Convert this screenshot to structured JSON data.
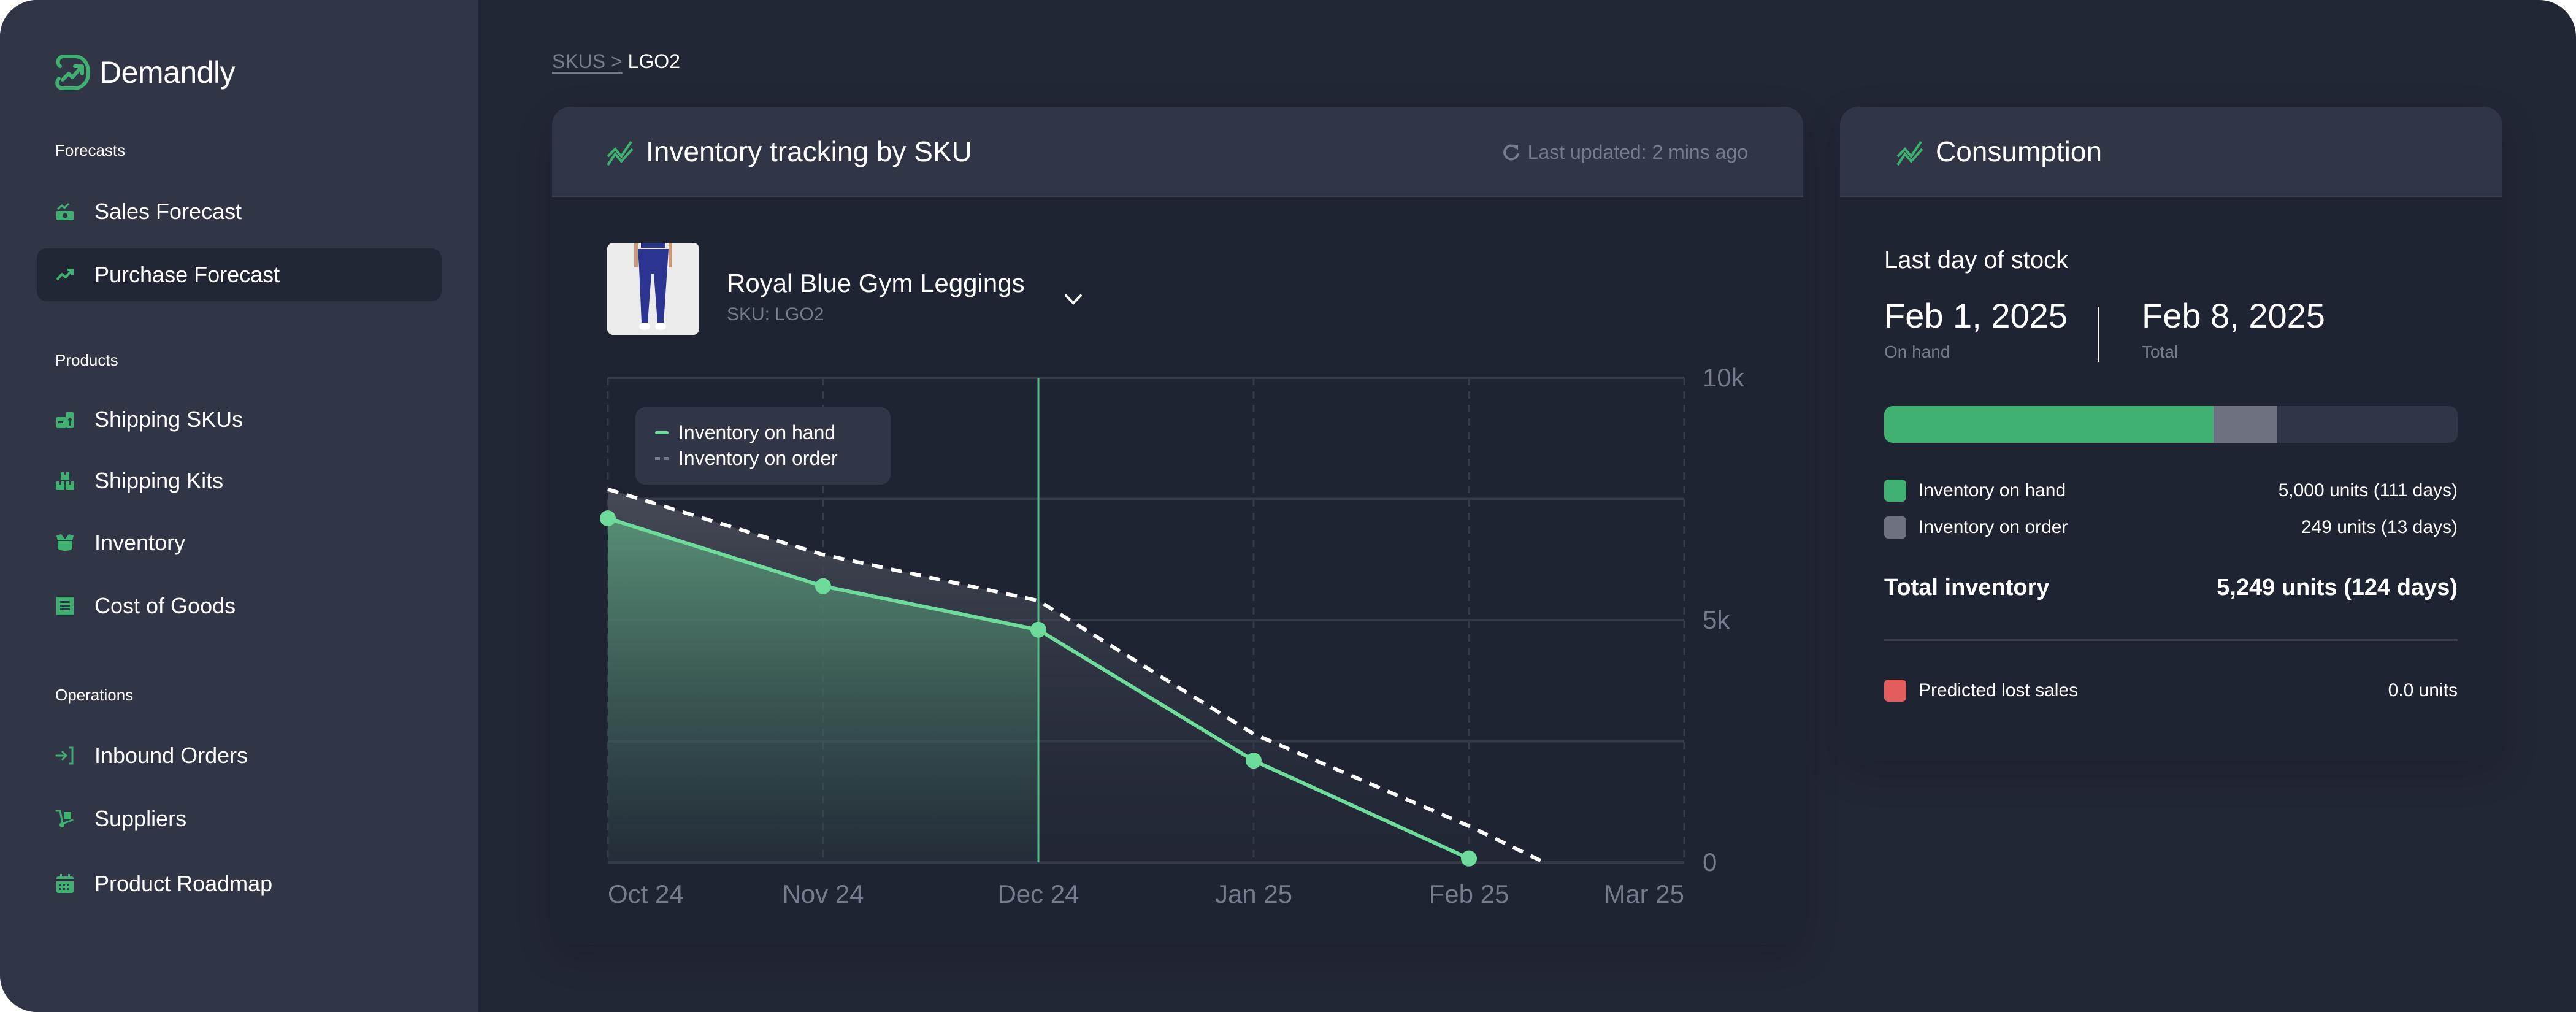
{
  "app": {
    "name": "Demandly"
  },
  "colors": {
    "accent": "#3fb06f",
    "line_green": "#6ddc9a",
    "on_order_gray": "#6e7280",
    "lost_sales_red": "#e35d5f",
    "sidebar_bg": "#313646",
    "main_bg": "#222736"
  },
  "sidebar": {
    "sections": [
      {
        "label": "Forecasts",
        "items": [
          {
            "label": "Sales Forecast",
            "icon": "sales-forecast-icon",
            "active": false
          },
          {
            "label": "Purchase Forecast",
            "icon": "trend-up-icon",
            "active": true
          }
        ]
      },
      {
        "label": "Products",
        "items": [
          {
            "label": "Shipping SKUs",
            "icon": "box-upload-icon",
            "active": false
          },
          {
            "label": "Shipping Kits",
            "icon": "boxes-icon",
            "active": false
          },
          {
            "label": "Inventory",
            "icon": "open-box-icon",
            "active": false
          },
          {
            "label": "Cost of Goods",
            "icon": "receipt-icon",
            "active": false
          }
        ]
      },
      {
        "label": "Operations",
        "items": [
          {
            "label": "Inbound Orders",
            "icon": "login-arrow-icon",
            "active": false
          },
          {
            "label": "Suppliers",
            "icon": "hand-truck-icon",
            "active": false
          },
          {
            "label": "Product Roadmap",
            "icon": "calendar-icon",
            "active": false
          }
        ]
      }
    ]
  },
  "breadcrumb": {
    "parent": "SKUS >",
    "current": "LGO2"
  },
  "inventory_card": {
    "title": "Inventory tracking by SKU",
    "last_updated": "Last updated: 2 mins ago",
    "product": {
      "name": "Royal Blue Gym Leggings",
      "sku": "SKU: LGO2"
    }
  },
  "chart_data": {
    "type": "area",
    "title": "Inventory tracking by SKU",
    "xlabel": "",
    "ylabel": "",
    "categories": [
      "Oct 24",
      "Nov 24",
      "Dec 24",
      "Jan 25",
      "Feb 25",
      "Mar 25"
    ],
    "y_ticks": [
      "10k",
      "5k",
      "0"
    ],
    "ylim": [
      0,
      10000
    ],
    "grid": true,
    "legend": {
      "position": "top-left",
      "entries": [
        "Inventory on hand",
        "Inventory on order"
      ]
    },
    "marker_category": "Dec 24",
    "series": [
      {
        "name": "Inventory on hand",
        "style": "solid",
        "x": [
          0,
          1,
          2,
          3,
          4
        ],
        "values": [
          7100,
          5700,
          4800,
          2100,
          80
        ]
      },
      {
        "name": "Inventory on order",
        "style": "dashed",
        "x": [
          0,
          1,
          2,
          3,
          4,
          4.35
        ],
        "values": [
          7700,
          6350,
          5400,
          2650,
          750,
          0
        ]
      }
    ]
  },
  "consumption_card": {
    "title": "Consumption",
    "subtitle": "Last day of stock",
    "on_hand_date": "Feb 1, 2025",
    "on_hand_label": "On hand",
    "total_date": "Feb 8, 2025",
    "total_label": "Total",
    "stock_bar": {
      "on_hand_fraction": 0.574,
      "on_order_fraction": 0.112
    },
    "rows": [
      {
        "label": "Inventory on hand",
        "value": "5,000 units (111 days)",
        "color": "#3fb06f"
      },
      {
        "label": "Inventory on order",
        "value": "249 units (13 days)",
        "color": "#6e7280"
      }
    ],
    "total": {
      "label": "Total inventory",
      "value": "5,249 units (124 days)"
    },
    "lost_sales": {
      "label": "Predicted lost sales",
      "value": "0.0 units",
      "color": "#e35d5f"
    }
  }
}
